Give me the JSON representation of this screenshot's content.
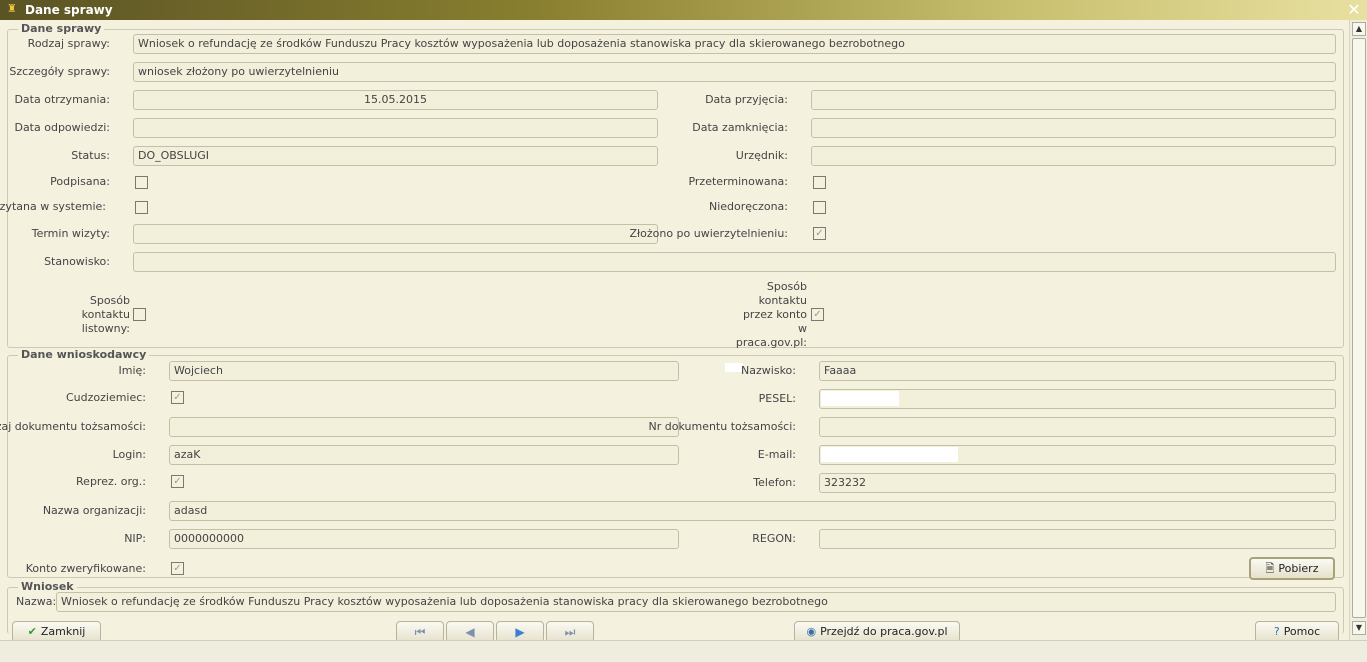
{
  "window": {
    "title": "Dane sprawy",
    "close_glyph": "✕"
  },
  "case_group": {
    "title": "Dane sprawy",
    "rodzaj_label": "Rodzaj sprawy:",
    "rodzaj_value": "Wniosek o refundację ze środków Funduszu Pracy kosztów wyposażenia lub doposażenia stanowiska pracy dla skierowanego bezrobotnego",
    "szczegoly_label": "Szczegóły sprawy:",
    "szczegoly_value": "wniosek złożony po uwierzytelnieniu",
    "data_otrzymania_label": "Data otrzymania:",
    "data_otrzymania_value": "15.05.2015",
    "data_przyjecia_label": "Data przyjęcia:",
    "data_przyjecia_value": "",
    "data_odpowiedzi_label": "Data odpowiedzi:",
    "data_odpowiedzi_value": "",
    "data_zamkniecia_label": "Data zamknięcia:",
    "data_zamkniecia_value": "",
    "status_label": "Status:",
    "status_value": "DO_OBSLUGI",
    "urzednik_label": "Urzędnik:",
    "urzednik_value": "",
    "podpisana_label": "Podpisana:",
    "podpisana_checked": false,
    "przeterminowana_label": "Przeterminowana:",
    "przeterminowana_checked": false,
    "wczytana_label": "Wczytana w systemie:",
    "wczytana_checked": false,
    "niedoreczona_label": "Niedoręczona:",
    "niedoreczona_checked": false,
    "termin_label": "Termin wizyty:",
    "termin_value": "",
    "zlozono_label": "Złożono po uwierzytelnieniu:",
    "zlozono_checked": true,
    "stanowisko_label": "Stanowisko:",
    "stanowisko_value": "",
    "kontakt_listowny_label": "Sposób kontaktu listowny:",
    "kontakt_listowny_checked": false,
    "kontakt_konto_label": "Sposób kontaktu przez konto w praca.gov.pl:",
    "kontakt_konto_checked": true
  },
  "applicant_group": {
    "title": "Dane wnioskodawcy",
    "imie_label": "Imię:",
    "imie_value": "Wojciech",
    "nazwisko_label": "Nazwisko:",
    "nazwisko_value": "Faaaa",
    "cudzoziemiec_label": "Cudzoziemiec:",
    "cudzoziemiec_checked": true,
    "pesel_label": "PESEL:",
    "pesel_value": "",
    "rodzaj_dok_label": "Rodzaj dokumentu tożsamości:",
    "rodzaj_dok_value": "",
    "nr_dok_label": "Nr dokumentu tożsamości:",
    "nr_dok_value": "",
    "login_label": "Login:",
    "login_value": "azaK",
    "email_label": "E-mail:",
    "email_value": "",
    "reprez_label": "Reprez. org.:",
    "reprez_checked": true,
    "telefon_label": "Telefon:",
    "telefon_value": "323232",
    "nazwa_org_label": "Nazwa organizacji:",
    "nazwa_org_value": "adasd",
    "nip_label": "NIP:",
    "nip_value": "0000000000",
    "regon_label": "REGON:",
    "regon_value": "",
    "konto_label": "Konto zweryfikowane:",
    "konto_checked": true,
    "pobierz_label": "Pobierz"
  },
  "request_group": {
    "title": "Wniosek",
    "nazwa_label": "Nazwa:",
    "nazwa_value": "Wniosek o refundację ze środków Funduszu Pracy kosztów wyposażenia lub doposażenia stanowiska pracy dla skierowanego bezrobotnego"
  },
  "footer": {
    "zamknij_label": "Zamknij",
    "przejdz_label": "Przejdź do praca.gov.pl",
    "pomoc_label": "Pomoc",
    "nav_first": "⏮",
    "nav_prev": "◀",
    "nav_next": "▶",
    "nav_last": "⏭"
  },
  "icons": {
    "window": "app-icon",
    "check": "check-icon",
    "document": "document-icon",
    "globe": "globe-icon",
    "help": "help-icon"
  },
  "colors": {
    "title_bar_start": "#5a5324",
    "title_bar_end": "#e8e0a0",
    "background": "#f4f1df",
    "field_bg": "#f2efdb",
    "accent_arrow": "#3b7fd4",
    "check_green": "#2e9e2e"
  }
}
